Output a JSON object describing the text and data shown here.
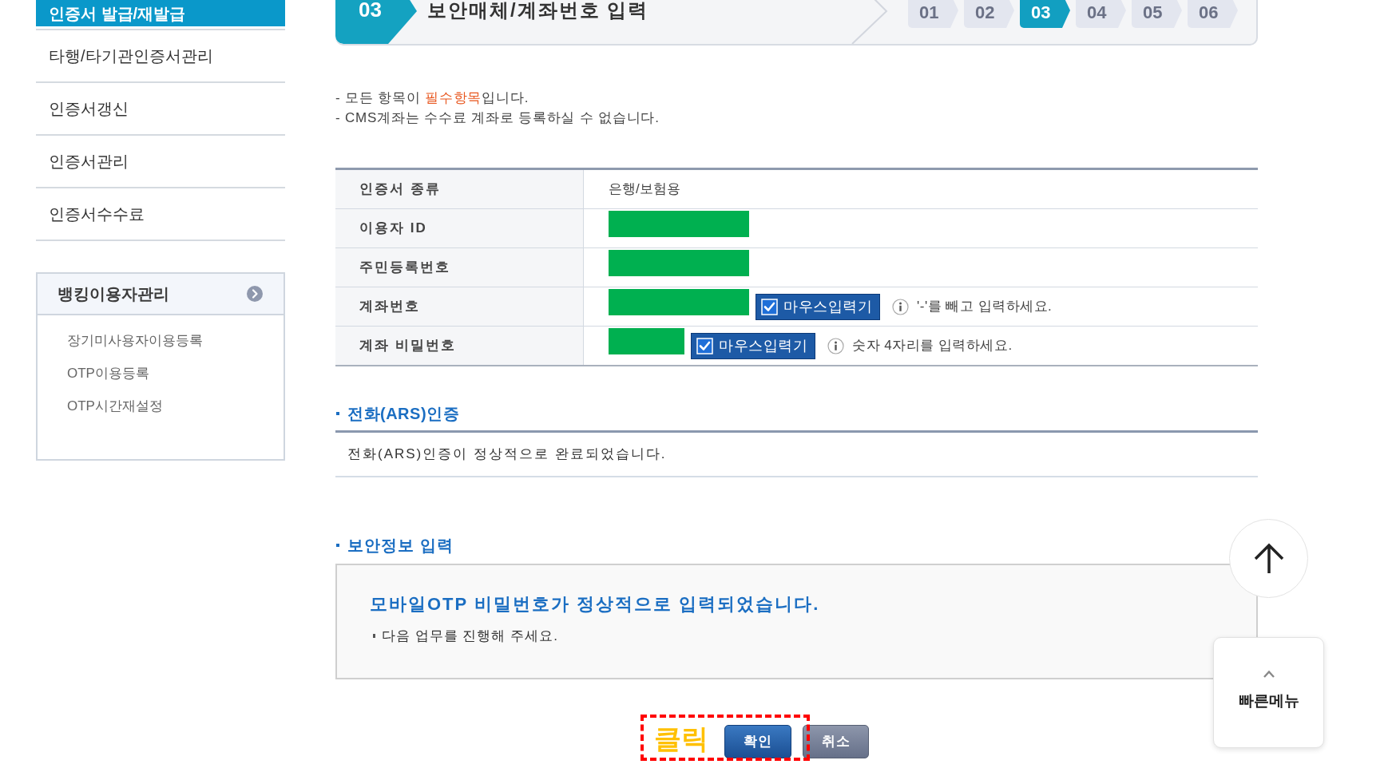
{
  "sidebar": {
    "items": [
      {
        "label": "인증서 발급/재발급",
        "selected": true
      },
      {
        "label": "타행/타기관인증서관리",
        "selected": false
      },
      {
        "label": "인증서갱신",
        "selected": false
      },
      {
        "label": "인증서관리",
        "selected": false
      },
      {
        "label": "인증서수수료",
        "selected": false
      }
    ],
    "panel": {
      "title": "뱅킹이용자관리",
      "items": [
        {
          "label": "장기미사용자이용등록"
        },
        {
          "label": "OTP이용등록"
        },
        {
          "label": "OTP시간재설정"
        }
      ]
    }
  },
  "step_header": {
    "number": "03",
    "title": "보안매체/계좌번호 입력",
    "steps": [
      {
        "label": "01",
        "selected": false
      },
      {
        "label": "02",
        "selected": false
      },
      {
        "label": "03",
        "selected": true
      },
      {
        "label": "04",
        "selected": false
      },
      {
        "label": "05",
        "selected": false
      },
      {
        "label": "06",
        "selected": false
      }
    ]
  },
  "notes": [
    {
      "parts": [
        {
          "text": "- 모든 항목이 ",
          "highlight": false
        },
        {
          "text": "필수항목",
          "highlight": true
        },
        {
          "text": "입니다.",
          "highlight": false
        }
      ]
    },
    {
      "parts": [
        {
          "text": "- CMS계좌는 수수료 계좌로 등록하실 수 없습니다.",
          "highlight": false
        }
      ]
    }
  ],
  "form_table": {
    "rows": [
      {
        "label": "인증서 종류",
        "kind": "text",
        "value": "은행/보험용"
      },
      {
        "label": "이용자 ID",
        "kind": "redacted"
      },
      {
        "label": "주민등록번호",
        "kind": "redacted"
      },
      {
        "label": "계좌번호",
        "kind": "redacted",
        "mouse_input": {
          "label": "마우스입력기",
          "checked": true
        },
        "hint": "'-'를 빼고 입력하세요."
      },
      {
        "label": "계좌 비밀번호",
        "kind": "password",
        "mouse_input": {
          "label": "마우스입력기",
          "checked": true
        },
        "hint": "숫자 4자리를 입력하세요."
      }
    ]
  },
  "ars_section": {
    "title": "전화(ARS)인증",
    "message": "전화(ARS)인증이 정상적으로 완료되었습니다."
  },
  "security_section": {
    "title": "보안정보 입력",
    "message": "모바일OTP 비밀번호가 정상적으로 입력되었습니다.",
    "note": "다음 업무를 진행해 주세요."
  },
  "buttons": [
    {
      "label": "확인",
      "kind": "primary"
    },
    {
      "label": "취소",
      "kind": "secondary"
    }
  ],
  "annotation": {
    "label": "클릭"
  },
  "quick_menu": {
    "label": "빠른메뉴"
  }
}
